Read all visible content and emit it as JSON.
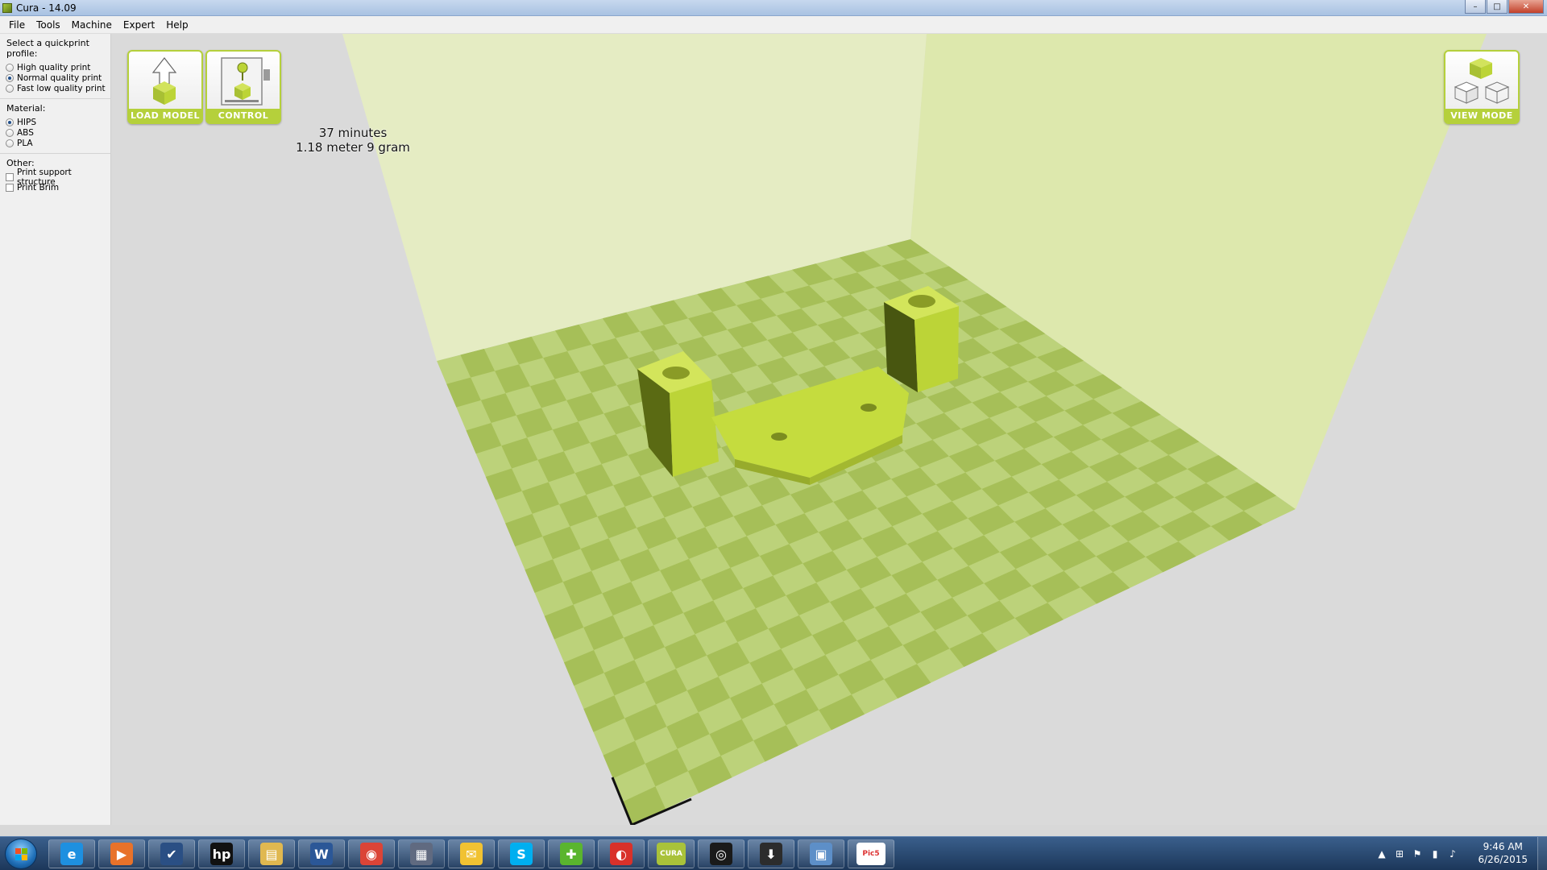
{
  "window": {
    "title": "Cura - 14.09",
    "controls": [
      "–",
      "□",
      "✕"
    ]
  },
  "menu": [
    "File",
    "Tools",
    "Machine",
    "Expert",
    "Help"
  ],
  "sidebar": {
    "profile_label": "Select a quickprint profile:",
    "profiles": [
      {
        "label": "High quality print",
        "selected": false
      },
      {
        "label": "Normal quality print",
        "selected": true
      },
      {
        "label": "Fast low quality print",
        "selected": false
      }
    ],
    "material_label": "Material:",
    "materials": [
      {
        "label": "HIPS",
        "selected": true
      },
      {
        "label": "ABS",
        "selected": false
      },
      {
        "label": "PLA",
        "selected": false
      }
    ],
    "other_label": "Other:",
    "other": [
      {
        "label": "Print support structure",
        "checked": false
      },
      {
        "label": "Print Brim",
        "checked": false
      }
    ]
  },
  "toolbar": {
    "load_model": "LOAD MODEL",
    "control": "CONTROL",
    "view_mode": "VIEW MODE"
  },
  "print_info": {
    "time": "37 minutes",
    "material": "1.18 meter 9 gram"
  },
  "colors": {
    "accent": "#b5d03b",
    "model": "#c6dd3c",
    "wall": "#e2ebb9"
  },
  "taskbar": {
    "apps": [
      {
        "name": "internet-explorer",
        "glyph": "e",
        "color": "#1e90e0"
      },
      {
        "name": "media-player",
        "glyph": "▶",
        "color": "#e8722a"
      },
      {
        "name": "check-app",
        "glyph": "✔",
        "color": "#2a4f84"
      },
      {
        "name": "hp",
        "glyph": "hp",
        "color": "#111111"
      },
      {
        "name": "file-explorer",
        "glyph": "▤",
        "color": "#e0b850"
      },
      {
        "name": "word",
        "glyph": "W",
        "color": "#2b5797"
      },
      {
        "name": "chrome",
        "glyph": "◉",
        "color": "#db4437"
      },
      {
        "name": "display-app",
        "glyph": "▦",
        "color": "#606a80"
      },
      {
        "name": "mail",
        "glyph": "✉",
        "color": "#f1c232"
      },
      {
        "name": "skype",
        "glyph": "S",
        "color": "#00aff0"
      },
      {
        "name": "puzzle-app",
        "glyph": "✚",
        "color": "#5ab52e"
      },
      {
        "name": "red-app",
        "glyph": "◐",
        "color": "#d9312a"
      },
      {
        "name": "cura",
        "glyph": "CURA",
        "color": "#a9c23a"
      },
      {
        "name": "lock-app",
        "glyph": "◎",
        "color": "#1a1a1a"
      },
      {
        "name": "printer-app",
        "glyph": "⬇",
        "color": "#2c2c2c"
      },
      {
        "name": "remote-app",
        "glyph": "▣",
        "color": "#5d8fc8"
      },
      {
        "name": "pics-app",
        "glyph": "Pic5",
        "color": "#ffffff"
      }
    ],
    "time": "9:46 AM",
    "date": "6/26/2015"
  }
}
